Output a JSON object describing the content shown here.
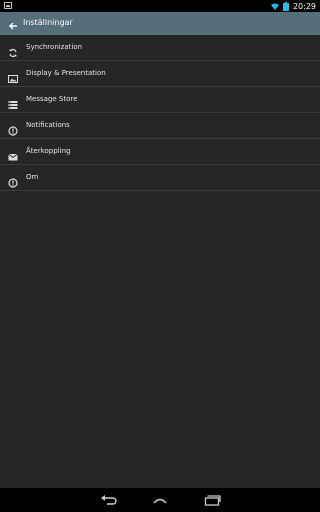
{
  "status": {
    "time": "20:29",
    "left_icon": "gallery-icon"
  },
  "appbar": {
    "title": "Inställningar",
    "back_icon": "arrow-back-icon"
  },
  "settings": [
    {
      "label": "Synchronization",
      "icon": "sync-icon"
    },
    {
      "label": "Display & Presentation",
      "icon": "image-icon"
    },
    {
      "label": "Message Store",
      "icon": "storage-icon"
    },
    {
      "label": "Notifications",
      "icon": "info-icon"
    },
    {
      "label": "Återkoppling",
      "icon": "mail-icon"
    },
    {
      "label": "Om",
      "icon": "info-icon"
    }
  ],
  "navbar": {
    "back_icon": "nav-back-icon",
    "home_icon": "nav-home-icon",
    "recents_icon": "nav-recents-icon"
  },
  "colors": {
    "appbar": "#546e7a",
    "background": "#262626",
    "statusbar": "#000000",
    "accent": "#33b5e5"
  }
}
